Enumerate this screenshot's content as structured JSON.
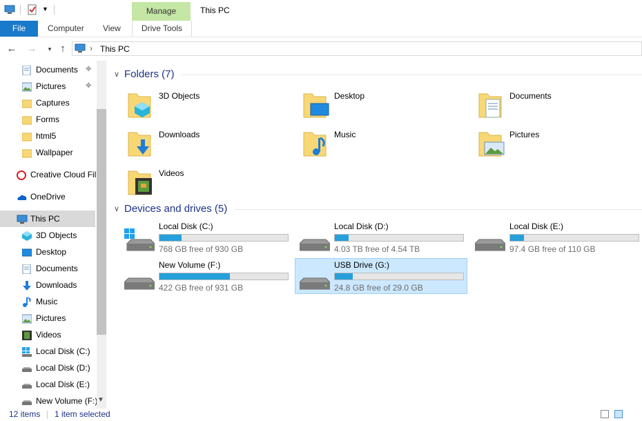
{
  "window": {
    "title": "This PC",
    "context_tab": "Manage"
  },
  "ribbon": {
    "tabs": [
      "File",
      "Computer",
      "View",
      "Drive Tools"
    ]
  },
  "address": {
    "path": "This PC"
  },
  "sidebar": {
    "items": [
      {
        "label": "Documents",
        "pinned": true
      },
      {
        "label": "Pictures",
        "pinned": true
      },
      {
        "label": "Captures"
      },
      {
        "label": "Forms"
      },
      {
        "label": "html5"
      },
      {
        "label": "Wallpaper"
      },
      {
        "label": "Creative Cloud Fil"
      },
      {
        "label": "OneDrive"
      },
      {
        "label": "This PC",
        "selected": true
      },
      {
        "label": "3D Objects"
      },
      {
        "label": "Desktop"
      },
      {
        "label": "Documents"
      },
      {
        "label": "Downloads"
      },
      {
        "label": "Music"
      },
      {
        "label": "Pictures"
      },
      {
        "label": "Videos"
      },
      {
        "label": "Local Disk (C:)"
      },
      {
        "label": "Local Disk (D:)"
      },
      {
        "label": "Local Disk (E:)"
      },
      {
        "label": "New Volume (F:)"
      }
    ]
  },
  "folders": {
    "header": "Folders (7)",
    "items": [
      "3D Objects",
      "Desktop",
      "Documents",
      "Downloads",
      "Music",
      "Pictures",
      "Videos"
    ]
  },
  "drives": {
    "header": "Devices and drives (5)",
    "items": [
      {
        "name": "Local Disk (C:)",
        "free": "768 GB free of 930 GB",
        "used_fraction": 0.17
      },
      {
        "name": "Local Disk (D:)",
        "free": "4.03 TB free of 4.54 TB",
        "used_fraction": 0.11
      },
      {
        "name": "Local Disk (E:)",
        "free": "97.4 GB free of 110 GB",
        "used_fraction": 0.11
      },
      {
        "name": "New Volume (F:)",
        "free": "422 GB free of 931 GB",
        "used_fraction": 0.55
      },
      {
        "name": "USB Drive (G:)",
        "free": "24.8 GB free of 29.0 GB",
        "used_fraction": 0.14,
        "selected": true
      }
    ]
  },
  "status": {
    "count": "12 items",
    "selection": "1 item selected"
  },
  "colors": {
    "accent": "#1979ca",
    "selection": "#cce8ff",
    "bar": "#26a0da",
    "header": "#1e3287"
  }
}
